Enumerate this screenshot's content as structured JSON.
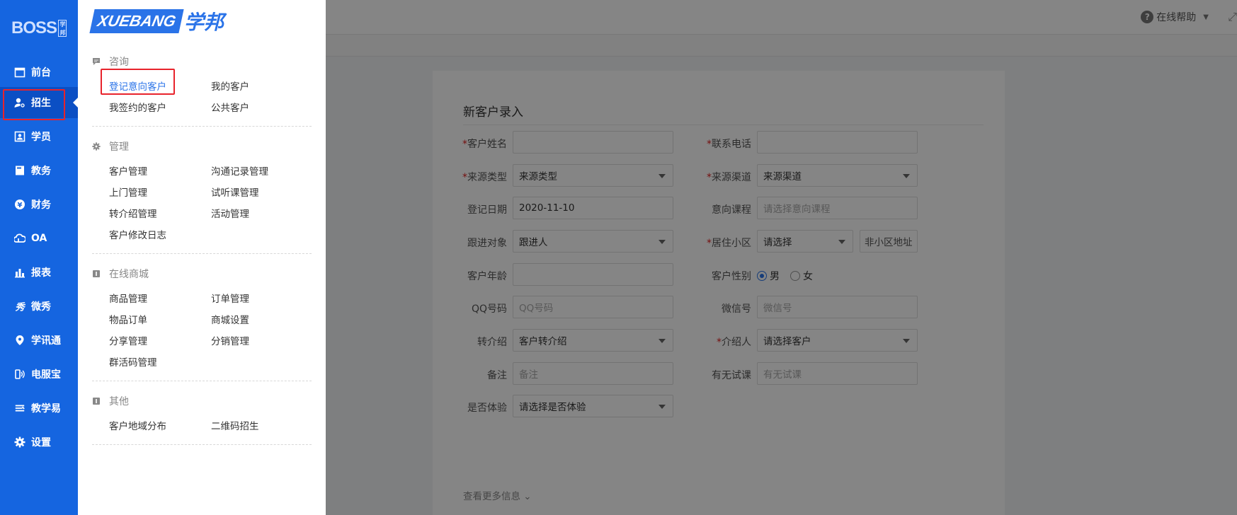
{
  "nav": {
    "logo": "BOSS",
    "logo_sub": "学邦",
    "items": [
      {
        "label": "前台",
        "icon": "calendar-icon"
      },
      {
        "label": "招生",
        "icon": "user-add-icon"
      },
      {
        "label": "学员",
        "icon": "id-card-icon"
      },
      {
        "label": "教务",
        "icon": "book-icon"
      },
      {
        "label": "财务",
        "icon": "yen-icon"
      },
      {
        "label": "OA",
        "icon": "cloud-icon"
      },
      {
        "label": "报表",
        "icon": "bar-chart-icon"
      },
      {
        "label": "微秀",
        "icon": "weixiu-icon"
      },
      {
        "label": "学讯通",
        "icon": "location-pin-icon"
      },
      {
        "label": "电服宝",
        "icon": "phone-signal-icon"
      },
      {
        "label": "教学易",
        "icon": "teach-icon"
      },
      {
        "label": "设置",
        "icon": "gear-icon"
      }
    ],
    "active": "招生"
  },
  "flyout": {
    "brand_en": "XUEBANG",
    "brand_cn": "学邦",
    "sections": [
      {
        "title": "咨询",
        "icon": "chat-icon",
        "links": [
          "登记意向客户",
          "我的客户",
          "我签约的客户",
          "公共客户"
        ]
      },
      {
        "title": "管理",
        "icon": "gear-icon",
        "links": [
          "客户管理",
          "沟通记录管理",
          "上门管理",
          "试听课管理",
          "转介绍管理",
          "活动管理",
          "客户修改日志"
        ]
      },
      {
        "title": "在线商城",
        "icon": "shop-icon",
        "links": [
          "商品管理",
          "订单管理",
          "物品订单",
          "商城设置",
          "分享管理",
          "分销管理",
          "群活码管理"
        ]
      },
      {
        "title": "其他",
        "icon": "other-icon",
        "links": [
          "客户地域分布",
          "二维码招生"
        ]
      }
    ],
    "selected": "登记意向客户"
  },
  "topbar": {
    "help": "在线帮助"
  },
  "form": {
    "title": "新客户录入",
    "fields": {
      "name_label": "客户姓名",
      "phone_label": "联系电话",
      "source_type_label": "来源类型",
      "source_type_value": "来源类型",
      "source_channel_label": "来源渠道",
      "source_channel_value": "来源渠道",
      "date_label": "登记日期",
      "date_value": "2020-11-10",
      "course_label": "意向课程",
      "course_placeholder": "请选择意向课程",
      "follower_label": "跟进对象",
      "follower_value": "跟进人",
      "community_label": "居住小区",
      "community_value": "请选择",
      "community_addr_placeholder": "非小区地址",
      "age_label": "客户年龄",
      "gender_label": "客户性别",
      "gender_male": "男",
      "gender_female": "女",
      "qq_label": "QQ号码",
      "qq_placeholder": "QQ号码",
      "wechat_label": "微信号",
      "wechat_placeholder": "微信号",
      "referral_label": "转介绍",
      "referral_value": "客户转介绍",
      "referrer_label": "介绍人",
      "referrer_value": "请选择客户",
      "remark_label": "备注",
      "remark_placeholder": "备注",
      "trial_label": "有无试课",
      "trial_placeholder": "有无试课",
      "experience_label": "是否体验",
      "experience_value": "请选择是否体验"
    },
    "more": "查看更多信息"
  },
  "colors": {
    "nav_bg": "#1565e0",
    "accent": "#2a73e8",
    "highlight": "#e8232c",
    "required": "#e02020"
  }
}
